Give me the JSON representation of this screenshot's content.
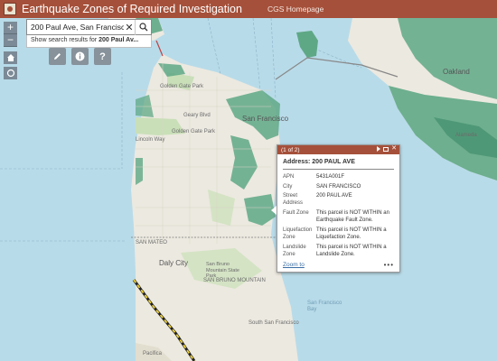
{
  "header": {
    "title": "Earthquake Zones of Required Investigation",
    "link": "CGS Homepage"
  },
  "search": {
    "value": "200 Paul Ave, San Francisco, Ca",
    "suggestion_prefix": "Show search results for ",
    "suggestion_term": "200 Paul Av..."
  },
  "zoom": {
    "in": "+",
    "out": "−"
  },
  "map_labels": {
    "san_francisco": "San Francisco",
    "golden_gate_park": "Golden Gate Park",
    "golden_gate_park_2": "Golden Gate Park",
    "oakland": "Oakland",
    "alameda": "Alameda",
    "san_mateo": "SAN MATEO",
    "daly_city": "Daly City",
    "san_bruno_mountain": "SAN BRUNO MOUNTAIN",
    "san_bruno_mountain_park": "San Bruno Mountain State Park",
    "south_san_francisco": "South San Francisco",
    "san_francisco_bay": "San Francisco Bay",
    "pacifica": "Pacifica",
    "geary_blvd": "Geary Blvd",
    "lincoln_way": "Lincoln Way"
  },
  "popup": {
    "counter": "(1 of 2)",
    "title": "Address: 200 PAUL AVE",
    "attributes": [
      {
        "key": "APN",
        "value": "5431A001F"
      },
      {
        "key": "City",
        "value": "SAN FRANCISCO"
      },
      {
        "key": "Street Address",
        "value": "200 PAUL AVE"
      },
      {
        "key": "Fault Zone",
        "value": "This parcel is NOT WITHIN an Earthquake Fault Zone."
      },
      {
        "key": "Liquefaction Zone",
        "value": "This parcel is NOT WITHIN a Liquefaction Zone."
      },
      {
        "key": "Landslide Zone",
        "value": "This parcel is NOT WITHIN a Landslide Zone."
      }
    ],
    "zoom_to": "Zoom to",
    "more": "•••"
  },
  "colors": {
    "header": "#a5503a",
    "water": "#b8dbe9",
    "land": "#ece9e0",
    "zone_green": "#5fa886",
    "park": "#c9dfb8"
  }
}
